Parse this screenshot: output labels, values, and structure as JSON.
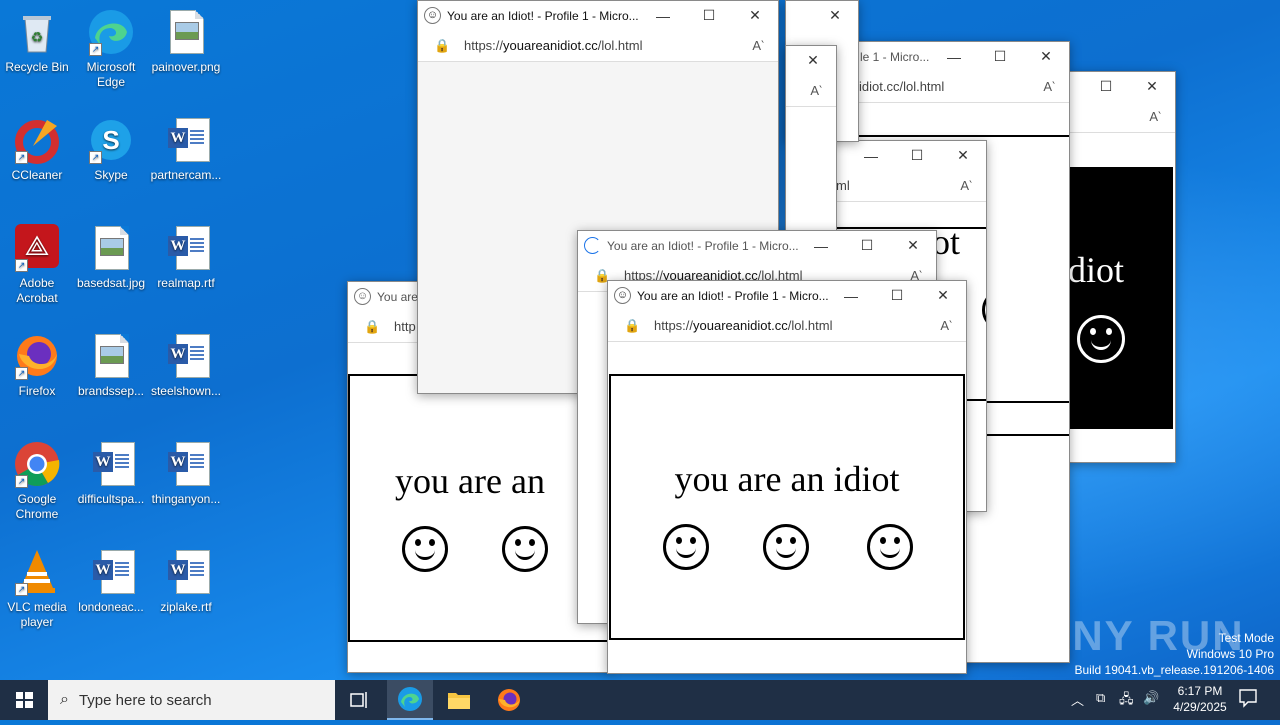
{
  "desktop": {
    "icons": [
      {
        "label": "Recycle Bin"
      },
      {
        "label": "Microsoft Edge"
      },
      {
        "label": "painover.png"
      },
      {
        "label": "CCleaner"
      },
      {
        "label": "Skype"
      },
      {
        "label": "partnercam..."
      },
      {
        "label": "Adobe Acrobat"
      },
      {
        "label": "basedsat.jpg"
      },
      {
        "label": "realmap.rtf"
      },
      {
        "label": "Firefox"
      },
      {
        "label": "brandssep..."
      },
      {
        "label": "steelshown..."
      },
      {
        "label": "Google Chrome"
      },
      {
        "label": "difficultspa..."
      },
      {
        "label": "thinganyon..."
      },
      {
        "label": "VLC media player"
      },
      {
        "label": "londoneac..."
      },
      {
        "label": "ziplake.rtf"
      }
    ]
  },
  "browser": {
    "title": "You are an Idiot! - Profile 1 - Micro...",
    "title_short": "You are a",
    "title_partial": "le 1 - Micro...",
    "url_prefix": "https://",
    "url_domain": "youareanidiot.cc",
    "url_path": "/lol.html",
    "url_fragment_right": "idiot.cc/lol.html",
    "url_fragment_left": "http",
    "url_fragment_ml": "ml",
    "read_aloud": "A‵",
    "content_text": "you are an idiot",
    "content_text_partial": "you are an",
    "content_text_idiot": "idiot",
    "content_text_ot": "ot",
    "minimize": "—",
    "maximize": "☐",
    "close": "✕"
  },
  "taskbar": {
    "search_placeholder": "Type here to search",
    "time": "6:17 PM",
    "date": "4/29/2025"
  },
  "watermark": {
    "line1": "Test Mode",
    "line2": "Windows 10 Pro",
    "line3": "Build 19041.vb_release.191206-1406",
    "brand": "ANY RUN"
  }
}
